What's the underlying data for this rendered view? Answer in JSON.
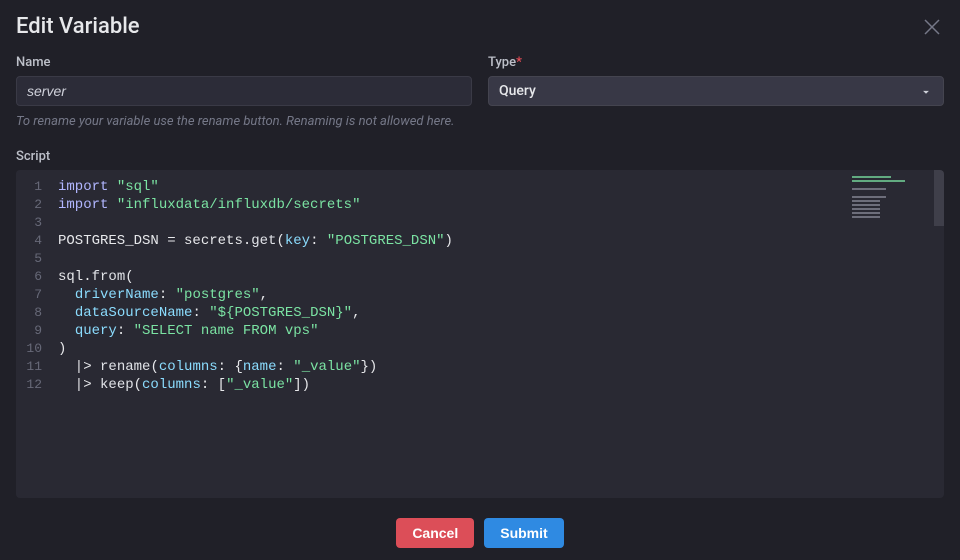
{
  "title": "Edit Variable",
  "fields": {
    "name": {
      "label": "Name",
      "value": "server",
      "helper": "To rename your variable use the rename button. Renaming is not allowed here."
    },
    "type": {
      "label": "Type",
      "required_mark": "*",
      "value": "Query"
    }
  },
  "script": {
    "label": "Script",
    "lines": [
      {
        "n": 1,
        "tokens": [
          [
            "key",
            "import"
          ],
          [
            "pun",
            " "
          ],
          [
            "str",
            "\"sql\""
          ]
        ]
      },
      {
        "n": 2,
        "tokens": [
          [
            "key",
            "import"
          ],
          [
            "pun",
            " "
          ],
          [
            "str",
            "\"influxdata/influxdb/secrets\""
          ]
        ]
      },
      {
        "n": 3,
        "tokens": []
      },
      {
        "n": 4,
        "tokens": [
          [
            "var",
            "POSTGRES_DSN "
          ],
          [
            "pun",
            "= "
          ],
          [
            "var",
            "secrets"
          ],
          [
            "pun",
            "."
          ],
          [
            "fn",
            "get"
          ],
          [
            "pun",
            "("
          ],
          [
            "param",
            "key"
          ],
          [
            "pun",
            ": "
          ],
          [
            "str",
            "\"POSTGRES_DSN\""
          ],
          [
            "pun",
            ")"
          ]
        ]
      },
      {
        "n": 5,
        "tokens": []
      },
      {
        "n": 6,
        "tokens": [
          [
            "var",
            "sql"
          ],
          [
            "pun",
            "."
          ],
          [
            "fn",
            "from"
          ],
          [
            "pun",
            "("
          ]
        ]
      },
      {
        "n": 7,
        "tokens": [
          [
            "pun",
            "  "
          ],
          [
            "param",
            "driverName"
          ],
          [
            "pun",
            ": "
          ],
          [
            "str",
            "\"postgres\""
          ],
          [
            "pun",
            ","
          ]
        ]
      },
      {
        "n": 8,
        "tokens": [
          [
            "pun",
            "  "
          ],
          [
            "param",
            "dataSourceName"
          ],
          [
            "pun",
            ": "
          ],
          [
            "str",
            "\"${POSTGRES_DSN}\""
          ],
          [
            "pun",
            ","
          ]
        ]
      },
      {
        "n": 9,
        "tokens": [
          [
            "pun",
            "  "
          ],
          [
            "param",
            "query"
          ],
          [
            "pun",
            ": "
          ],
          [
            "str",
            "\"SELECT name FROM vps\""
          ]
        ]
      },
      {
        "n": 10,
        "tokens": [
          [
            "pun",
            ")"
          ]
        ]
      },
      {
        "n": 11,
        "tokens": [
          [
            "pun",
            "  |> "
          ],
          [
            "fn",
            "rename"
          ],
          [
            "pun",
            "("
          ],
          [
            "param",
            "columns"
          ],
          [
            "pun",
            ": {"
          ],
          [
            "param",
            "name"
          ],
          [
            "pun",
            ": "
          ],
          [
            "str",
            "\"_value\""
          ],
          [
            "pun",
            "})"
          ]
        ]
      },
      {
        "n": 12,
        "tokens": [
          [
            "pun",
            "  |> "
          ],
          [
            "fn",
            "keep"
          ],
          [
            "pun",
            "("
          ],
          [
            "param",
            "columns"
          ],
          [
            "pun",
            ": ["
          ],
          [
            "str",
            "\"_value\""
          ],
          [
            "pun",
            "])"
          ]
        ]
      }
    ]
  },
  "buttons": {
    "cancel": "Cancel",
    "submit": "Submit"
  },
  "colors": {
    "bg": "#202028",
    "editor_bg": "#292933",
    "accent_red": "#dc4e58",
    "accent_blue": "#2f8ae2"
  }
}
